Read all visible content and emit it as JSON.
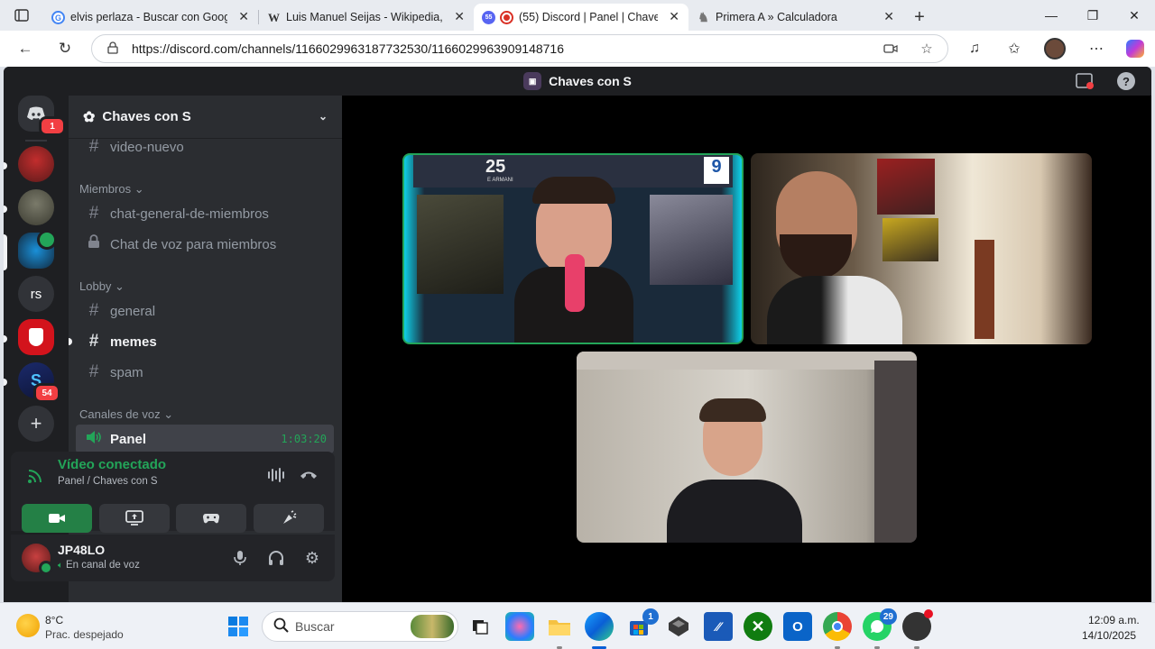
{
  "browser": {
    "tabs": [
      {
        "title": "elvis perlaza - Buscar con Google",
        "active": false
      },
      {
        "title": "Luis Manuel Seijas - Wikipedia, la",
        "active": false
      },
      {
        "title": "(55) Discord | Panel | Chaves",
        "active": true,
        "badge": "55"
      },
      {
        "title": "Primera A » Calculadora",
        "active": false
      }
    ],
    "url": "https://discord.com/channels/1166029963187732530/1166029963909148716"
  },
  "discord": {
    "title": "Chaves con S",
    "rail": {
      "home_badge": "1",
      "text_server_label": "rs",
      "server_badge": "54"
    },
    "server_name": "Chaves con S",
    "channels": {
      "top": "video-nuevo",
      "cat_members": "Miembros",
      "members_chat": "chat-general-de-miembros",
      "members_voice": "Chat de voz para miembros",
      "cat_lobby": "Lobby",
      "lobby": [
        "general",
        "memes",
        "spam"
      ],
      "cat_voice": "Canales de voz",
      "voice_channel": "Panel",
      "voice_timer": "1:03:20"
    },
    "voice": {
      "status": "Vídeo conectado",
      "location": "Panel / Chaves con S"
    },
    "user": {
      "name": "JP48LO",
      "status": "En canal de voz"
    },
    "stage_overlays": {
      "tile1_text_a": "25",
      "tile1_text_b": "E ARMANI",
      "tile1_text_c": "9"
    }
  },
  "taskbar": {
    "weather_temp": "8°C",
    "weather_desc": "Prac. despejado",
    "search_placeholder": "Buscar",
    "store_badge": "1",
    "whatsapp_badge": "29",
    "time": "12:09 a.m.",
    "date": "14/10/2025"
  },
  "colors": {
    "discord_bg": "#1e1f22",
    "sidebar_bg": "#2b2d31",
    "green": "#23a559",
    "speaking_border": "#23a559",
    "badge_red": "#f23f43"
  }
}
